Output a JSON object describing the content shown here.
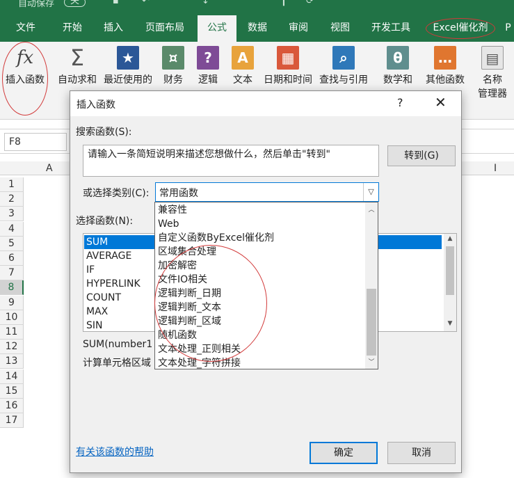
{
  "colors": {
    "ribbon_green": "#217346",
    "select_blue": "#0078d7",
    "annotation_red": "#d23a3a",
    "link_blue": "#0563c1"
  },
  "quick_access": {
    "autosave_label": "自动保存",
    "toggle_label": "关"
  },
  "ribbon_tabs": [
    "文件",
    "开始",
    "插入",
    "页面布局",
    "公式",
    "数据",
    "审阅",
    "视图",
    "开发工具",
    "Excel催化剂",
    "P"
  ],
  "ribbon_buttons": [
    {
      "label": "插入函数",
      "icon": "function-icon"
    },
    {
      "label": "自动求和",
      "icon": "sigma-icon"
    },
    {
      "label": "最近使用的",
      "icon": "star-book-icon"
    },
    {
      "label": "财务",
      "icon": "coins-book-icon"
    },
    {
      "label": "逻辑",
      "icon": "question-book-icon"
    },
    {
      "label": "文本",
      "icon": "text-book-icon"
    },
    {
      "label": "日期和时间",
      "icon": "calendar-book-icon"
    },
    {
      "label": "查找与引用",
      "icon": "search-book-icon"
    },
    {
      "label": "数学和",
      "icon": "theta-book-icon"
    },
    {
      "label": "其他函数",
      "icon": "more-book-icon"
    },
    {
      "label": "名称",
      "label2": "管理器",
      "icon": "tags-icon"
    }
  ],
  "name_box": "F8",
  "columns": [
    "A",
    "I"
  ],
  "rows": [
    "1",
    "2",
    "3",
    "4",
    "5",
    "6",
    "7",
    "8",
    "9",
    "10",
    "11",
    "12",
    "13",
    "14",
    "15",
    "16",
    "17"
  ],
  "selected_row": "8",
  "dialog": {
    "title": "插入函数",
    "help_glyph": "?",
    "close_glyph": "✕",
    "search_label": "搜索函数(S):",
    "search_text": "请输入一条简短说明来描述您想做什么，然后单击\"转到\"",
    "go_button": "转到(G)",
    "category_label": "或选择类别(C):",
    "category_value": "常用函数",
    "function_label": "选择函数(N):",
    "functions": [
      "SUM",
      "AVERAGE",
      "IF",
      "HYPERLINK",
      "COUNT",
      "MAX",
      "SIN"
    ],
    "syntax": "SUM(number1",
    "description": "计算单元格区域",
    "help_link": "有关该函数的帮助",
    "ok_button": "确定",
    "cancel_button": "取消"
  },
  "category_options": [
    "兼容性",
    "Web",
    "自定义函数ByExcel催化剂",
    "区域集合处理",
    "加密解密",
    "文件IO相关",
    "逻辑判断_日期",
    "逻辑判断_文本",
    "逻辑判断_区域",
    "随机函数",
    "文本处理_正则相关",
    "文本处理_字符拼接"
  ]
}
